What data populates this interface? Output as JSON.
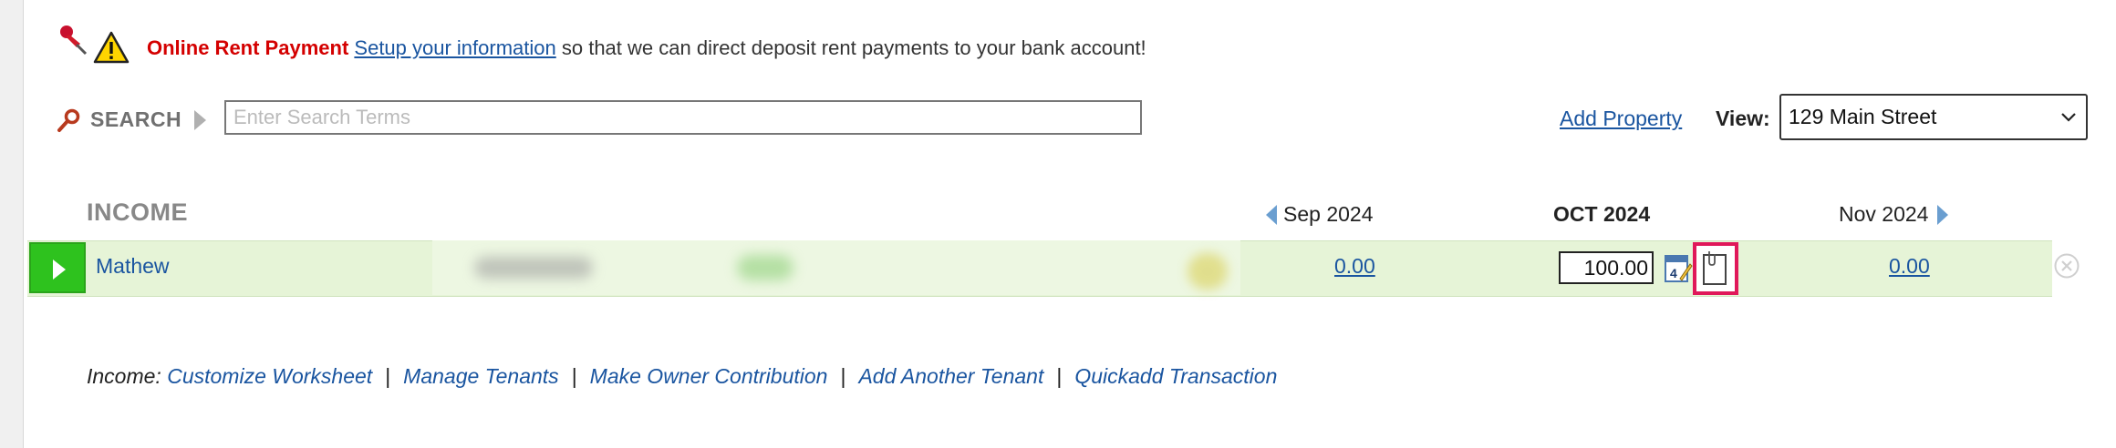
{
  "notice": {
    "title": "Online Rent Payment",
    "link_text": "Setup your information",
    "message": " so that we can direct deposit rent payments to your bank account!"
  },
  "search": {
    "label": "SEARCH",
    "placeholder": "Enter Search Terms"
  },
  "header": {
    "add_property": "Add Property",
    "view_label": "View:",
    "view_value": "129 Main Street"
  },
  "worksheet": {
    "section_title": "INCOME",
    "months": {
      "prev": "Sep 2024",
      "current": "OCT 2024",
      "next": "Nov 2024"
    },
    "rows": [
      {
        "tenant": "Mathew",
        "prev_value": "0.00",
        "current_value": "100.00",
        "next_value": "0.00"
      }
    ]
  },
  "footer": {
    "label": "Income:",
    "links": [
      "Customize Worksheet",
      "Manage Tenants",
      "Make Owner Contribution",
      "Add Another Tenant",
      "Quickadd Transaction"
    ],
    "separator": "|"
  },
  "colors": {
    "alert_red": "#d40000",
    "link_blue": "#1a55a0",
    "row_green": "#e6f4d7",
    "expand_green": "#2ec21e",
    "highlight_pink": "#e0185a"
  },
  "icons": [
    "pushpin-icon",
    "warning-icon",
    "search-icon",
    "chevron-down-icon",
    "calendar-icon",
    "note-icon",
    "remove-icon"
  ]
}
